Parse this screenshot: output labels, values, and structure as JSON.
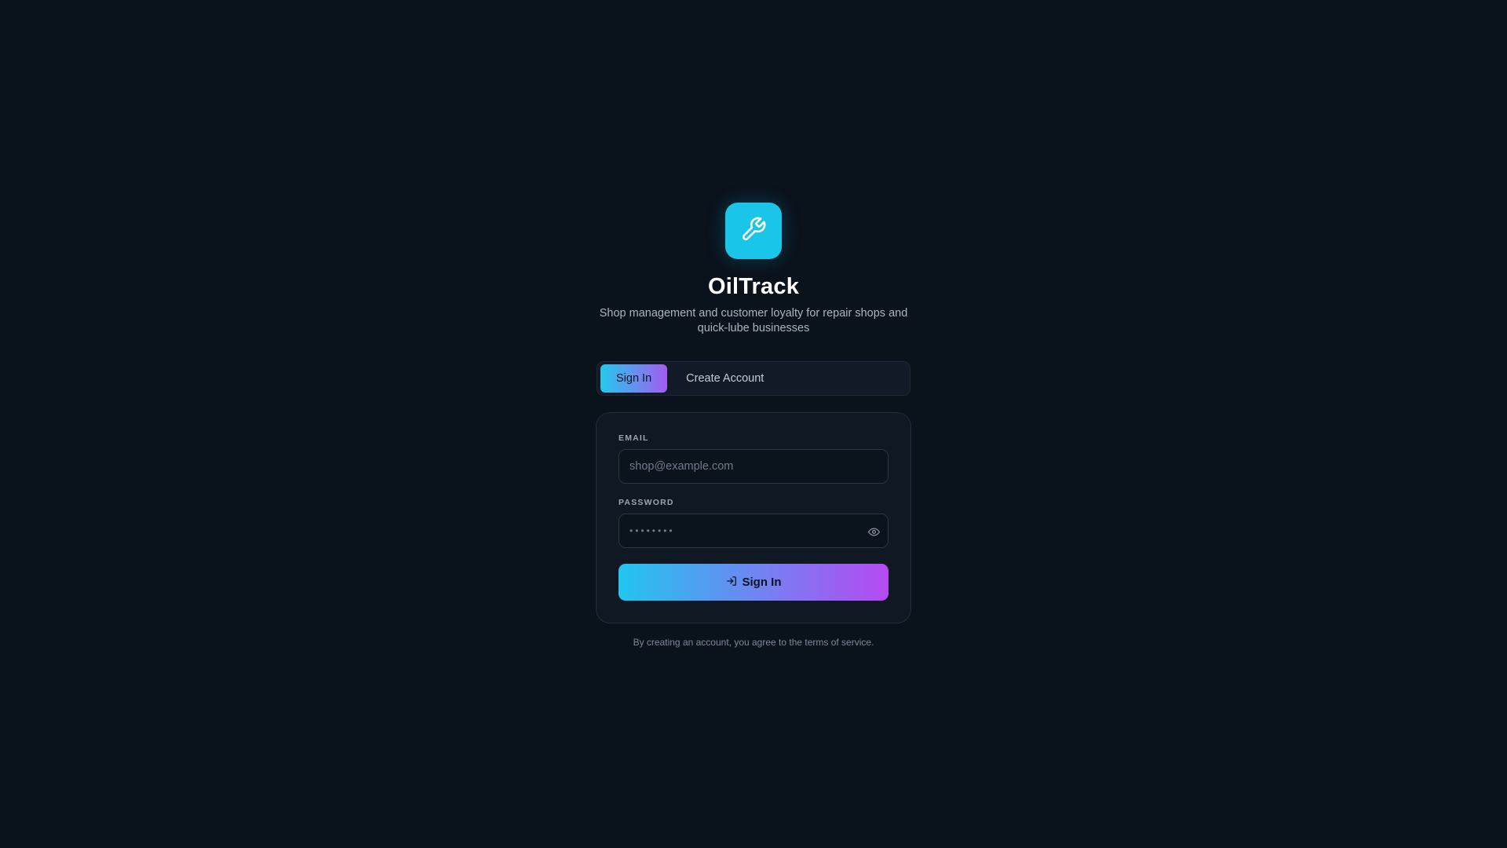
{
  "app": {
    "name": "OilTrack",
    "tagline": "Shop management and customer loyalty for repair shops and quick-lube businesses",
    "logo_icon": "wrench-icon",
    "accent_cyan": "#19c6ea",
    "accent_purple": "#b54af1"
  },
  "tabs": [
    {
      "label": "Sign In",
      "active": true
    },
    {
      "label": "Create Account",
      "active": false
    }
  ],
  "form": {
    "email": {
      "label": "EMAIL",
      "value": "",
      "placeholder": "shop@example.com"
    },
    "password": {
      "label": "PASSWORD",
      "value": "",
      "placeholder": "••••••••",
      "toggle_icon": "eye-icon"
    },
    "submit": {
      "label": "Sign In",
      "icon": "sign-in-icon"
    }
  },
  "footer": {
    "terms": "By creating an account, you agree to the terms of service."
  }
}
